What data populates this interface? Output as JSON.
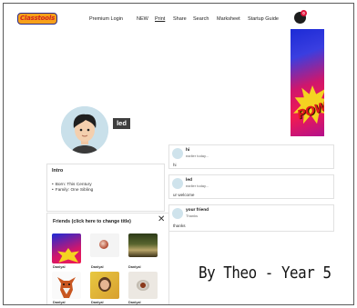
{
  "header": {
    "logo_text": "Classtools",
    "nav": [
      {
        "label": "Premium Login",
        "id": "premium-login"
      },
      {
        "label": "NEW",
        "id": "new"
      },
      {
        "label": "Print",
        "id": "print"
      },
      {
        "label": "Share",
        "id": "share"
      },
      {
        "label": "Search",
        "id": "search"
      },
      {
        "label": "Marksheet",
        "id": "marksheet"
      },
      {
        "label": "Startup Guide",
        "id": "startup-guide"
      }
    ],
    "notification_count": "0"
  },
  "banner": {
    "text": "POW!"
  },
  "profile": {
    "name": "led"
  },
  "intro": {
    "title": "Intro",
    "items": [
      "Born: This Century",
      "Family: One Sibling"
    ]
  },
  "friends": {
    "title": "Friends (click here to change title)",
    "close_label": "✕",
    "list": [
      {
        "name": "Daniyal",
        "image": "comic-pow"
      },
      {
        "name": "Daniyal",
        "image": "lollipop"
      },
      {
        "name": "Daniyal",
        "image": "forest"
      },
      {
        "name": "Daniyal",
        "image": "fox"
      },
      {
        "name": "Daniyal",
        "image": "portrait"
      },
      {
        "name": "Daniyal",
        "image": "bowl"
      }
    ]
  },
  "posts": [
    {
      "author": "hi",
      "time": "earlier today...",
      "body": "hi"
    },
    {
      "author": "led",
      "time": "earlier today...",
      "body": "ur welcome"
    },
    {
      "author": "your friend",
      "time": "Thanks",
      "body": "thanks"
    }
  ],
  "caption": "By Theo - Year 5",
  "colors": {
    "logo_bg": "#f7a11a",
    "logo_text": "#d3261f",
    "notification": "#e0143c"
  }
}
